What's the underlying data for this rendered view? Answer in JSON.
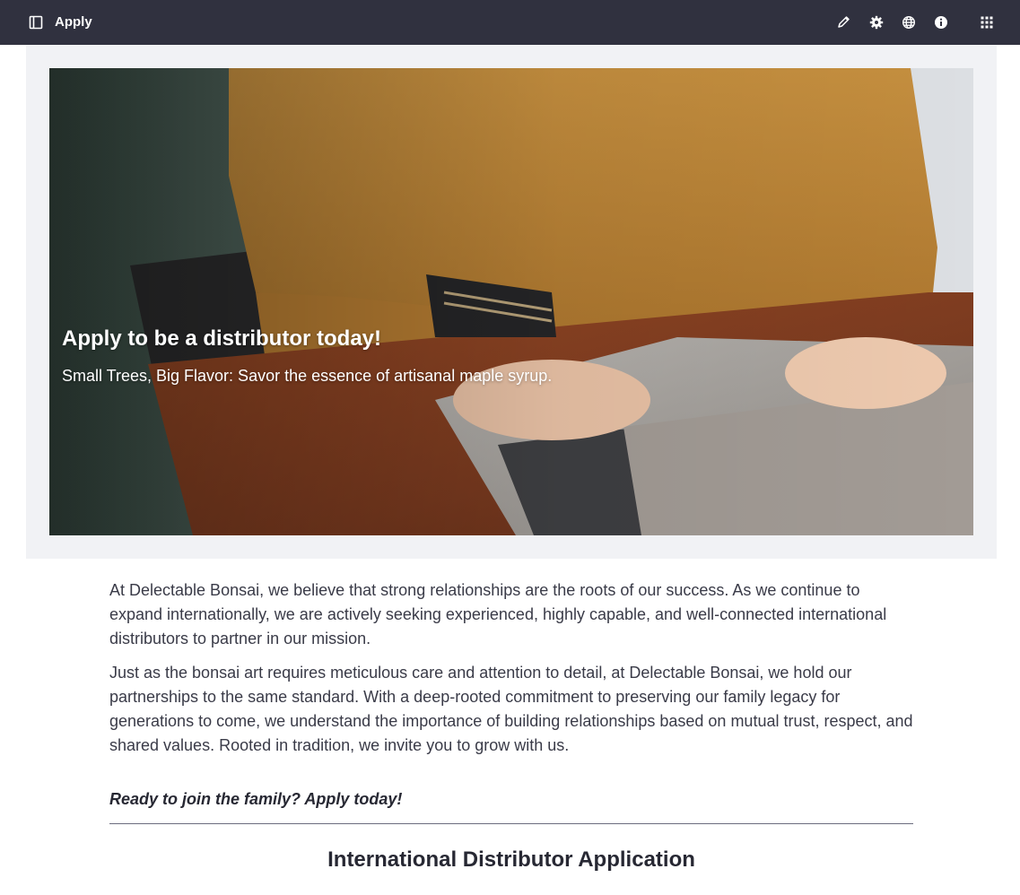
{
  "topbar": {
    "title": "Apply",
    "icons": [
      "sidebar-toggle-icon",
      "pencil-icon",
      "gear-icon",
      "globe-icon",
      "info-icon",
      "apps-grid-icon"
    ],
    "background": "#30313f"
  },
  "hero": {
    "title": "Apply to be a distributor today!",
    "subtitle": "Small Trees, Big Flavor: Savor the essence of artisanal maple syrup."
  },
  "content": {
    "paragraph_1": "At Delectable Bonsai, we believe that strong relationships are the roots of our success. As we continue to expand internationally, we are actively seeking experienced, highly capable, and well-connected international distributors to partner in our mission.",
    "paragraph_2": "Just as the bonsai art requires meticulous care and attention to detail, at Delectable Bonsai, we hold our partnerships to the same standard. With a deep-rooted commitment to preserving our family legacy for generations to come, we understand the importance of building relationships based on mutual trust, respect, and shared values. Rooted in tradition, we invite you to grow with us.",
    "cta": "Ready to join the family? Apply today!"
  },
  "form": {
    "title": "International Distributor Application"
  }
}
